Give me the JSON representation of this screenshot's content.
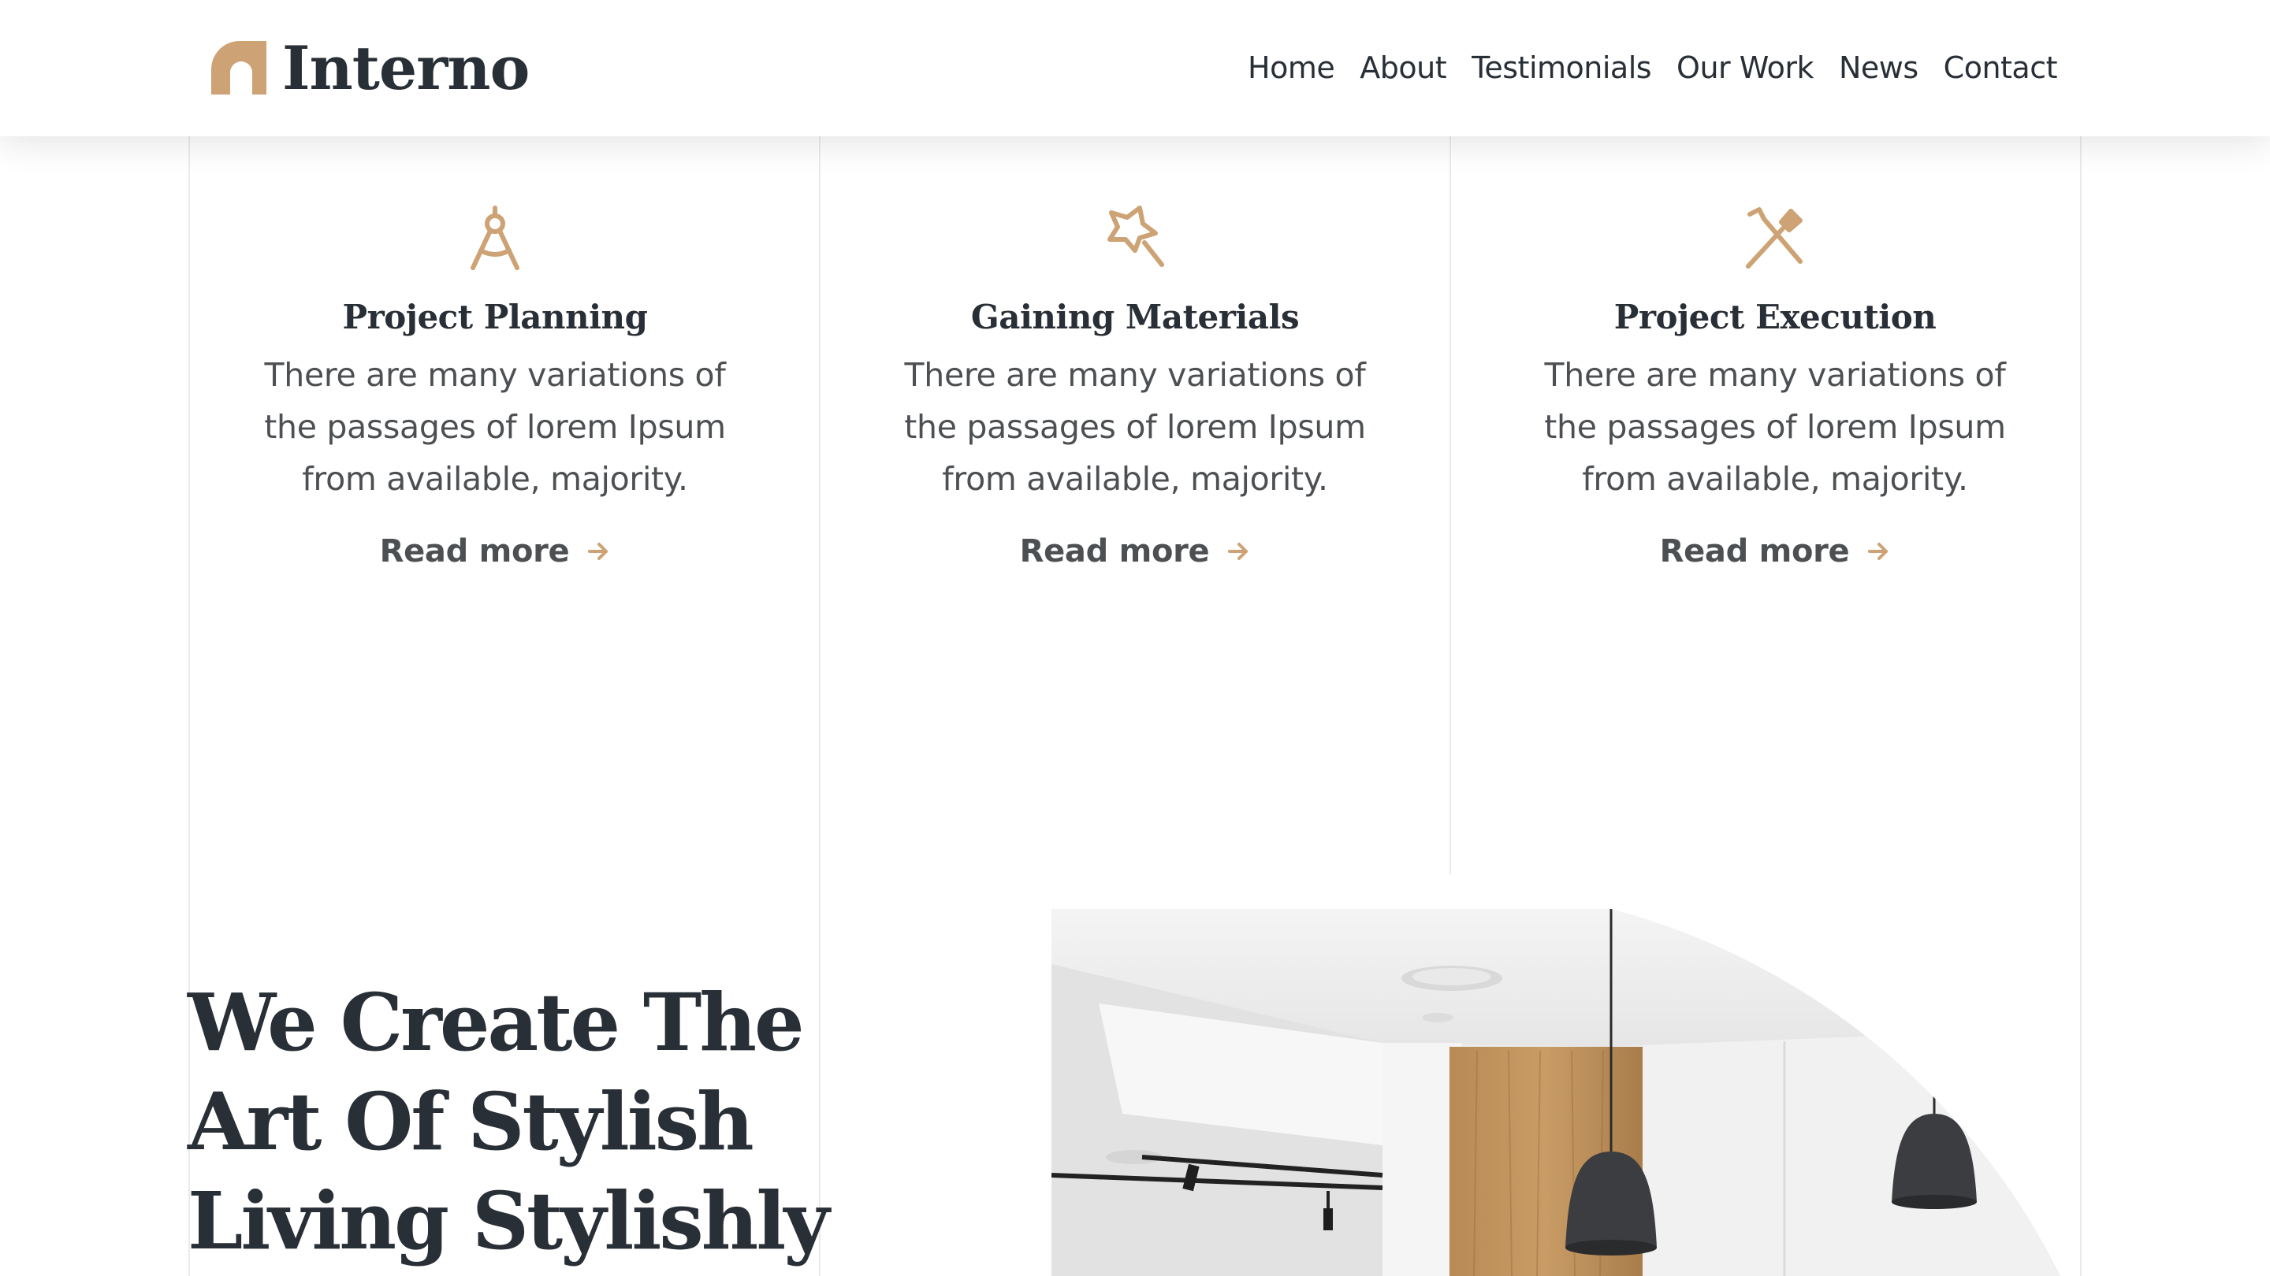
{
  "brand": {
    "name": "Interno",
    "accent": "#cda274",
    "dark": "#292f36",
    "text": "#4d5053"
  },
  "nav": [
    "Home",
    "About",
    "Testimonials",
    "Our Work",
    "News",
    "Contact"
  ],
  "services": [
    {
      "icon": "compass-icon",
      "title": "Project Planning",
      "text": "There are many variations of the passages of lorem Ipsum from available, majority.",
      "link": "Read more"
    },
    {
      "icon": "magic-wand-star-icon",
      "title": "Gaining Materials",
      "text": "There are many variations of the passages of lorem Ipsum from available, majority.",
      "link": "Read more"
    },
    {
      "icon": "tools-crossed-icon",
      "title": "Project Execution",
      "text": "There are many variations of the passages of lorem Ipsum from available, majority.",
      "link": "Read more"
    }
  ],
  "hero": {
    "title": "We Create The Art Of Stylish Living Stylishly"
  }
}
